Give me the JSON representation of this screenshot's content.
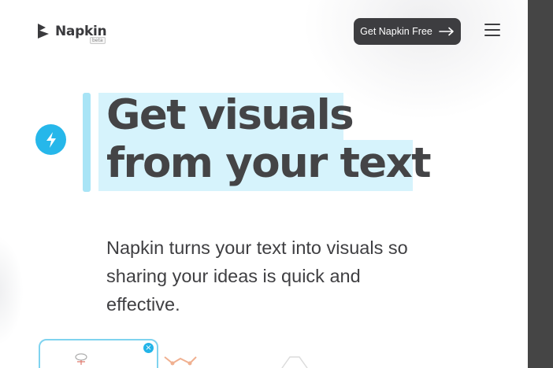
{
  "header": {
    "logo_text": "Napkin",
    "logo_badge": "beta",
    "cta_label": "Get Napkin Free",
    "menu_icon": "hamburger-menu-icon"
  },
  "hero": {
    "headline_line1": "Get visuals",
    "headline_line2": "from your text",
    "subheadline": "Napkin turns your text into visuals so sharing your ideas is quick and effective.",
    "badge_icon": "lightning-bolt-icon"
  },
  "colors": {
    "accent": "#26b7ea",
    "highlight": "#d6f3fc",
    "button": "#3d3d40",
    "scrollbar": "#454545"
  }
}
